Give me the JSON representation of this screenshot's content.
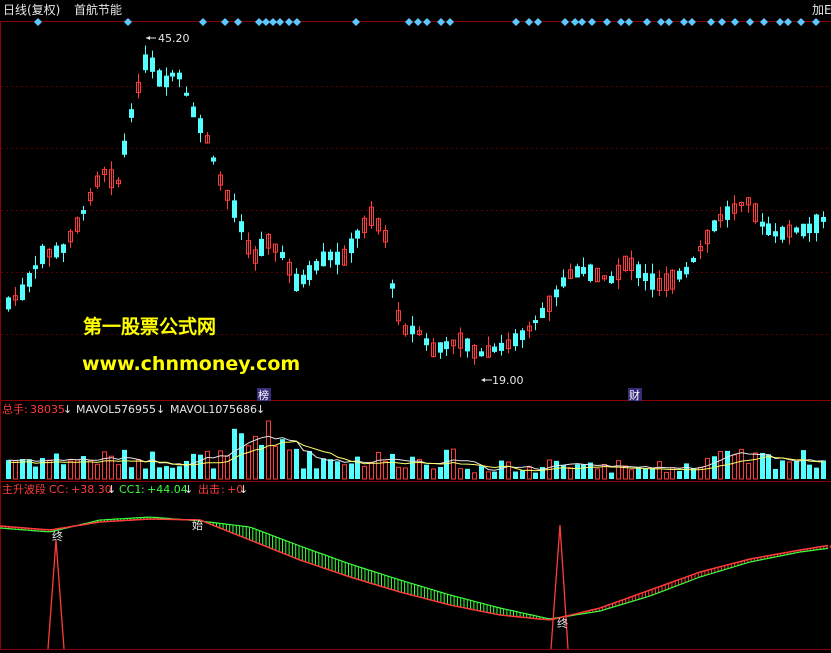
{
  "header": {
    "title": "日线(复权)",
    "stock_name": "首航节能",
    "right_label": "加E"
  },
  "price_panel": {
    "high_label": "45.20",
    "low_label": "19.00",
    "marker_bang": "榜",
    "marker_cai": "财"
  },
  "watermark": {
    "line1": "第一股票公式网",
    "line2": "www.chnmoney.com"
  },
  "volume_panel": {
    "total_label": "总手",
    "total_value": "38035",
    "mavol5_label": "MAVOL5",
    "mavol5_value": "76955",
    "mavol10_label": "MAVOL10",
    "mavol10_value": "75686"
  },
  "indicator_panel": {
    "name": "主升波段",
    "cc_label": "CC",
    "cc_value": "+38.30",
    "cc1_label": "CC1",
    "cc1_value": "+44.04",
    "chuji_label": "出击",
    "chuji_value": "+0",
    "marker_zhong": "终",
    "marker_shi": "始"
  },
  "colors": {
    "up": "#ff3b3b",
    "down": "#54ffff",
    "yellow": "#ffff00",
    "green": "#3cff3c",
    "marker_blue": "#5bc8ff",
    "grid": "#8b0000",
    "purple_tag": "#3a2a7a"
  }
}
